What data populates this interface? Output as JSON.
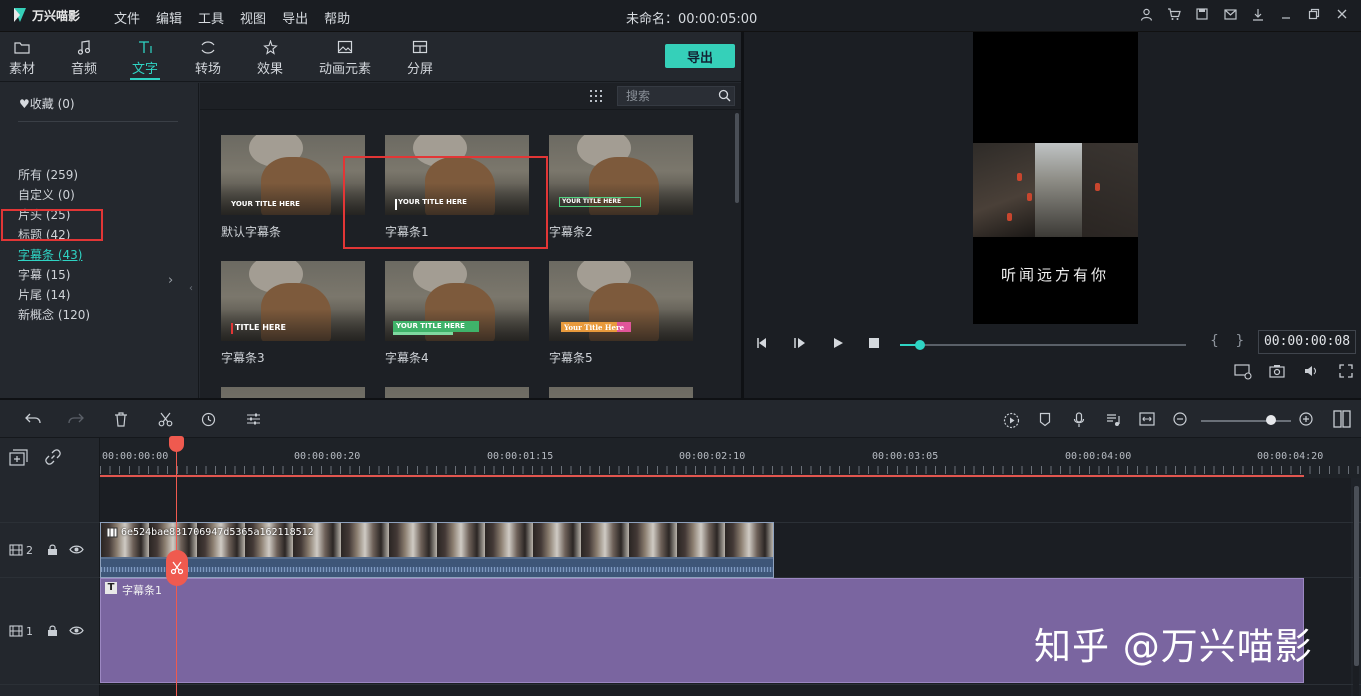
{
  "app": {
    "name": "万兴喵影",
    "doc_title": "未命名：00:00:05:00"
  },
  "menu": [
    "文件",
    "编辑",
    "工具",
    "视图",
    "导出",
    "帮助"
  ],
  "tabs": [
    {
      "label": "素材",
      "icon": "folder-icon"
    },
    {
      "label": "音频",
      "icon": "music-note-icon"
    },
    {
      "label": "文字",
      "icon": "text-icon"
    },
    {
      "label": "转场",
      "icon": "transition-icon"
    },
    {
      "label": "效果",
      "icon": "effects-icon"
    },
    {
      "label": "动画元素",
      "icon": "image-icon"
    },
    {
      "label": "分屏",
      "icon": "split-screen-icon"
    }
  ],
  "active_tab": "文字",
  "export_label": "导出",
  "categories": {
    "favorites": "♥收藏 (0)",
    "items": [
      "所有 (259)",
      "自定义 (0)",
      "片头 (25)",
      "标题 (42)",
      "字幕条 (43)",
      "字幕 (15)",
      "片尾 (14)",
      "新概念 (120)"
    ],
    "active": "字幕条 (43)"
  },
  "search": {
    "placeholder": "搜索"
  },
  "thumbnails": [
    {
      "label": "默认字幕条",
      "caption": "YOUR TITLE HERE"
    },
    {
      "label": "字幕条1",
      "caption": "YOUR TITLE HERE"
    },
    {
      "label": "字幕条2",
      "caption": "YOUR TITLE HERE"
    },
    {
      "label": "字幕条3",
      "caption": "TITLE HERE"
    },
    {
      "label": "字幕条4",
      "caption": "YOUR TITLE HERE"
    },
    {
      "label": "字幕条5",
      "caption": "Your Title Here"
    }
  ],
  "preview": {
    "caption": "听闻远方有你",
    "timecode": "00:00:00:08",
    "braces": "{ }",
    "progress_fraction": 0.07
  },
  "ruler": [
    "00:00:00:00",
    "00:00:00:20",
    "00:00:01:15",
    "00:00:02:10",
    "00:00:03:05",
    "00:00:04:00",
    "00:00:04:20"
  ],
  "tracks": [
    {
      "number": "2",
      "clip_name": "6e524bae831706947d5365a162118512"
    },
    {
      "number": "1",
      "clip_name": "字幕条1"
    }
  ],
  "watermark": "知乎 @万兴喵影",
  "colors": {
    "accent": "#2fd4c4",
    "highlight": "#e23636",
    "playhead": "#ef5a4f",
    "text_clip": "#7a65a0",
    "video_clip": "#5a6f8d"
  }
}
